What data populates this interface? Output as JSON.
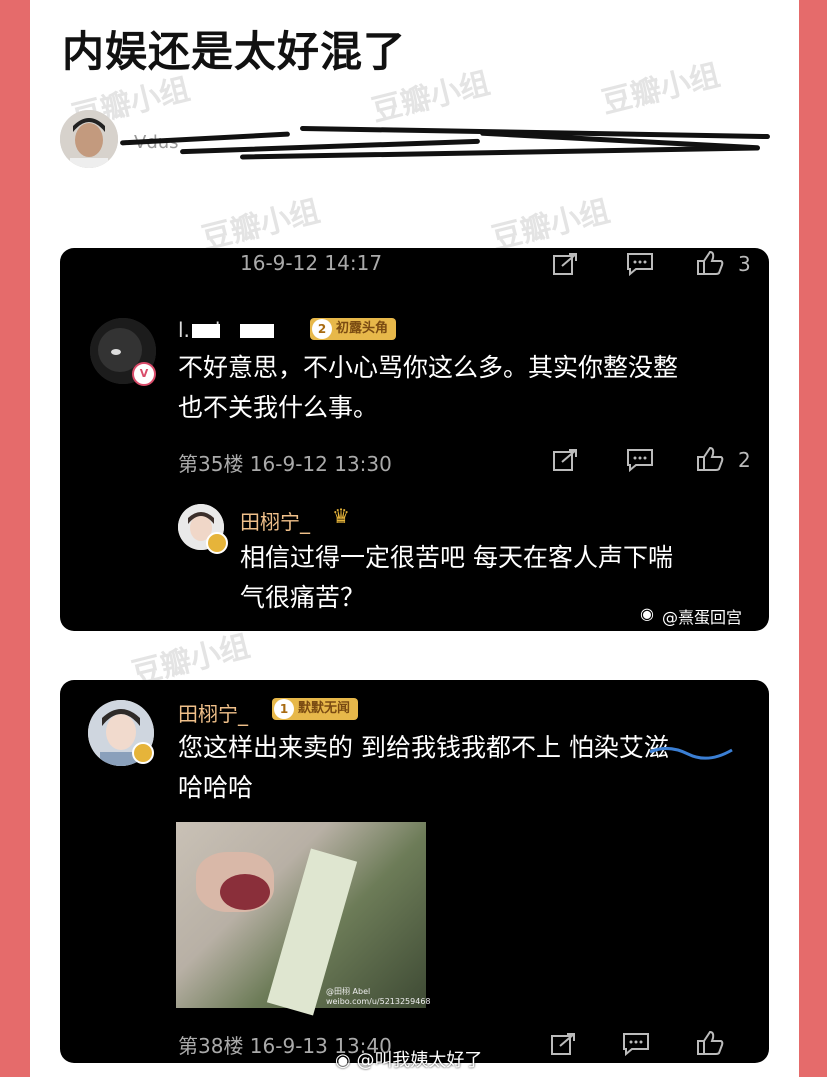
{
  "post": {
    "title": "内娱还是太好混了",
    "poster_name": "Vdus",
    "watermark": "豆瓣小组"
  },
  "card1": {
    "top_time": "16-9-12 14:17",
    "top_likes": "3",
    "comment": {
      "username": "l...el",
      "medal_level": "2",
      "medal_text": "初露头角",
      "text_line1": "不好意思，不小心骂你这么多。其实你整没整",
      "text_line2": "也不关我什么事。",
      "floor_time": "第35楼 16-9-12 13:30",
      "likes": "2"
    },
    "reply": {
      "username": "田栩宁_",
      "text_line1": "相信过得一定很苦吧 每天在客人声下喘",
      "text_line2": "气很痛苦？"
    },
    "source_watermark": "@熹蛋回宫"
  },
  "card2": {
    "comment": {
      "username": "田栩宁_",
      "medal_level": "1",
      "medal_text": "默默无闻",
      "text_line1": "您这样出来卖的 到给我钱我都不上 怕染艾滋",
      "text_line2": "哈哈哈",
      "photo_caption": "@田栩 Abel",
      "photo_url_caption": "weibo.com/u/5213259468",
      "floor_time": "第38楼 16-9-13 13:40"
    }
  },
  "footer_watermark": "@叫我姨太好了",
  "colors": {
    "frame": "#e56b6b",
    "card": "#000000",
    "username": "#f0c08a",
    "medal": "#e7b84a"
  }
}
